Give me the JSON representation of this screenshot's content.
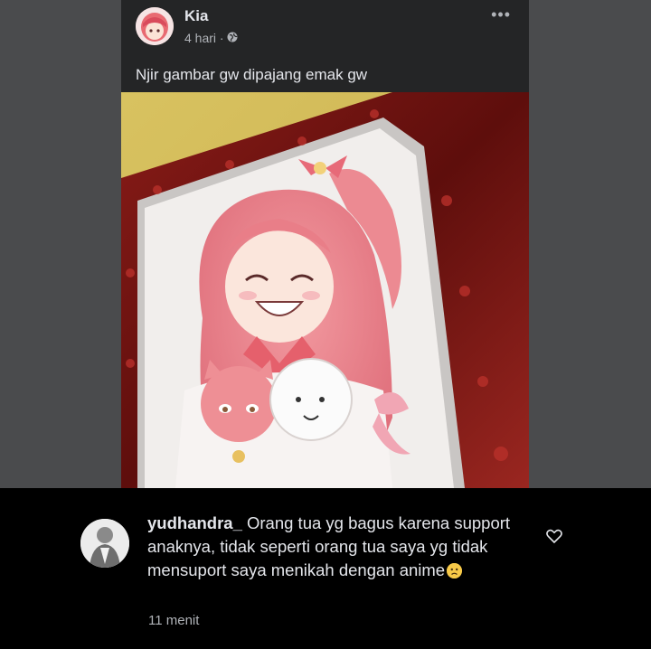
{
  "post": {
    "author": "Kia",
    "time": "4 hari ·",
    "privacy_icon": "globe-icon",
    "more_icon": "more-options-icon",
    "more_label": "•••",
    "caption": "Njir gambar gw dipajang emak gw",
    "photo_subject": "framed-anime-drawing"
  },
  "comment": {
    "username": "yudhandra_",
    "text": " Orang tua yg bagus karena support anaknya, tidak seperti orang tua saya yg tidak mensuport saya menikah dengan anime",
    "emoji": "worried-face-emoji",
    "time": "11 menit",
    "like_icon": "heart-outline-icon"
  },
  "colors": {
    "background": "#4a4b4d",
    "card": "#242526",
    "comment_bg": "#000000",
    "frame": "#7a1512",
    "wall": "#d9c35a"
  }
}
